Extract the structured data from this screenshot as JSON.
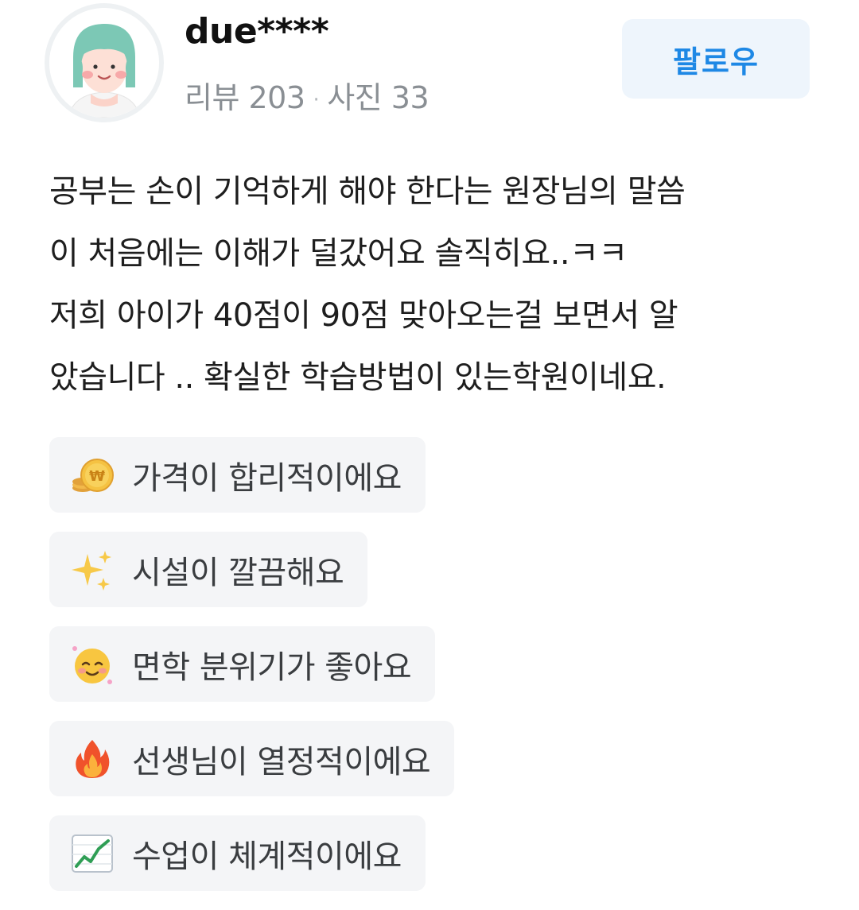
{
  "review": {
    "author": {
      "name": "due****",
      "review_label": "리뷰 203",
      "separator": "·",
      "photo_label": "사진 33"
    },
    "follow_button": "팔로우",
    "body_lines": [
      "공부는 손이 기억하게 해야 한다는 원장님의 말씀",
      "이 처음에는 이해가 덜갔어요 솔직히요..ㅋㅋ",
      "저희 아이가 40점이 90점 맞아오는걸 보면서 알",
      "았습니다 .. 확실한 학습방법이 있는학원이네요."
    ],
    "tags": [
      {
        "icon": "coin-icon",
        "label": "가격이 합리적이에요"
      },
      {
        "icon": "sparkles-icon",
        "label": "시설이 깔끔해요"
      },
      {
        "icon": "smiling-face-icon",
        "label": "면학 분위기가 좋아요"
      },
      {
        "icon": "fire-icon",
        "label": "선생님이 열정적이에요"
      },
      {
        "icon": "chart-increasing-icon",
        "label": "수업이 체계적이에요"
      }
    ]
  },
  "colors": {
    "follow_text": "#1e88e5",
    "follow_bg": "#eef5fc",
    "tag_bg": "#f4f5f7",
    "meta_text": "#8a8f94"
  }
}
